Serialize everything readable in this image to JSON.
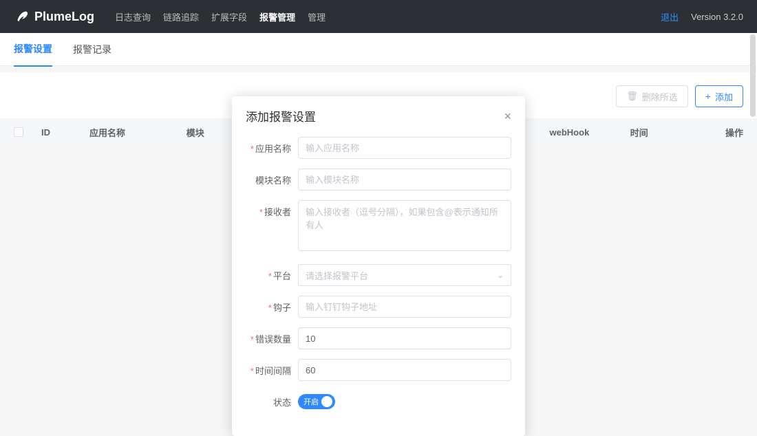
{
  "header": {
    "app_name": "PlumeLog",
    "version": "Version 3.2.0",
    "logout": "退出",
    "nav": [
      {
        "label": "日志查询"
      },
      {
        "label": "链路追踪"
      },
      {
        "label": "扩展字段"
      },
      {
        "label": "报警管理",
        "active": true
      },
      {
        "label": "管理"
      }
    ]
  },
  "tabs": [
    {
      "label": "报警设置",
      "active": true
    },
    {
      "label": "报警记录"
    }
  ],
  "actions": {
    "delete": "删除所选",
    "add": "添加"
  },
  "table": {
    "cols": {
      "id": "ID",
      "app": "应用名称",
      "module": "模块",
      "webhook": "webHook",
      "time": "时间",
      "op": "操作"
    }
  },
  "modal": {
    "title": "添加报警设置",
    "fields": {
      "app": {
        "label": "应用名称",
        "placeholder": "输入应用名称",
        "required": true
      },
      "module": {
        "label": "模块名称",
        "placeholder": "输入模块名称",
        "required": false
      },
      "receiver": {
        "label": "接收者",
        "placeholder": "输入接收者（逗号分隔），如果包含@表示通知所有人",
        "required": true
      },
      "platform": {
        "label": "平台",
        "placeholder": "请选择报警平台",
        "required": true
      },
      "hook": {
        "label": "钩子",
        "placeholder": "输入钉钉钩子地址",
        "required": true
      },
      "count": {
        "label": "错误数量",
        "value": "10",
        "required": true
      },
      "interval": {
        "label": "时间间隔",
        "value": "60",
        "required": true
      },
      "status": {
        "label": "状态",
        "switch_text": "开启"
      }
    }
  }
}
